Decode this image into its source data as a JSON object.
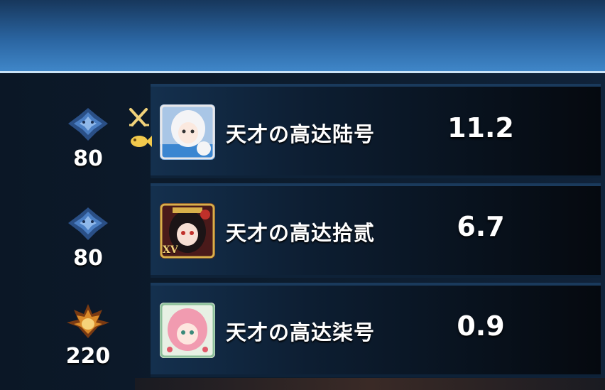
{
  "rows": [
    {
      "rank_icon": "blue-dragon-crest-icon",
      "rank_number": "80",
      "side_icons": [
        "crossed-swords-icon",
        "fish-icon"
      ],
      "avatar_icon": "white-haired-character-avatar",
      "name": "天才の高达陆号",
      "value": "11.2"
    },
    {
      "rank_icon": "blue-dragon-crest-icon",
      "rank_number": "80",
      "side_icons": [],
      "avatar_icon": "dark-haired-character-avatar",
      "avatar_badge": "XV",
      "name": "天才の高达拾贰",
      "value": "6.7"
    },
    {
      "rank_icon": "golden-flame-crest-icon",
      "rank_number": "220",
      "side_icons": [],
      "avatar_icon": "pink-haired-character-avatar",
      "name": "天才の高达柒号",
      "value": "0.9"
    }
  ],
  "colors": {
    "banner_top": "#17375c",
    "banner_bottom": "#3f86c8",
    "row_panel": "#0d1e32",
    "text": "#ffffff",
    "gold_accent": "#f2c94c"
  }
}
